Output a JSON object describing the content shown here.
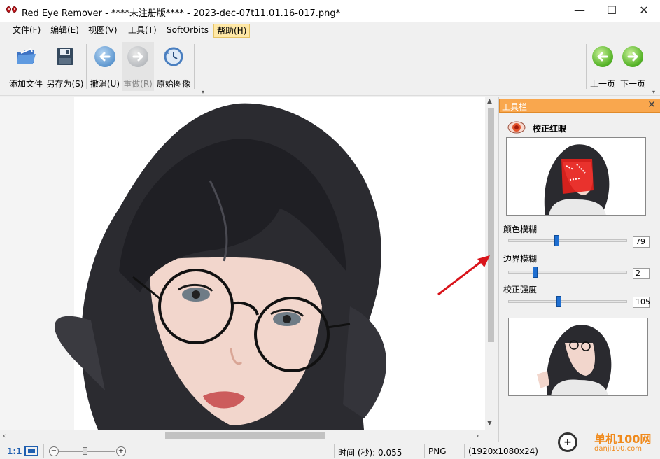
{
  "window": {
    "title": "Red Eye Remover - ****未注册版**** - 2023-dec-07t11.01.16-017.png*",
    "minimize": "—",
    "maximize": "☐",
    "close": "✕"
  },
  "menu": {
    "file": "文件(F)",
    "edit": "编辑(E)",
    "view": "视图(V)",
    "tools": "工具(T)",
    "softorbits": "SoftOrbits",
    "help": "帮助(H)"
  },
  "toolbar": {
    "add_file": "添加文件",
    "save_as": "另存为(S)",
    "undo": "撤消(U)",
    "redo": "重做(R)",
    "original": "原始图像",
    "prev_page": "上一页",
    "next_page": "下一页"
  },
  "panel": {
    "title": "工具栏",
    "close": "✕",
    "section": "校正红眼",
    "sliders": [
      {
        "label": "颜色模糊",
        "value": "79",
        "fraction": 0.4
      },
      {
        "label": "边界模糊",
        "value": "2",
        "fraction": 0.22
      },
      {
        "label": "校正强度",
        "value": "105",
        "fraction": 0.42
      }
    ]
  },
  "status": {
    "zoom_ratio": "1:1",
    "zoom_minus": "−",
    "zoom_plus": "+",
    "time": "时间 (秒): 0.055",
    "format": "PNG",
    "dimensions": "(1920x1080x24)"
  },
  "watermark": {
    "text": "单机100网",
    "sub": "danji100.com"
  },
  "colors": {
    "panel_header": "#f9a74e",
    "slider_knob": "#1f6fd1",
    "help_highlight": "#ffe8a6",
    "annotation_arrow": "#d9141b"
  }
}
